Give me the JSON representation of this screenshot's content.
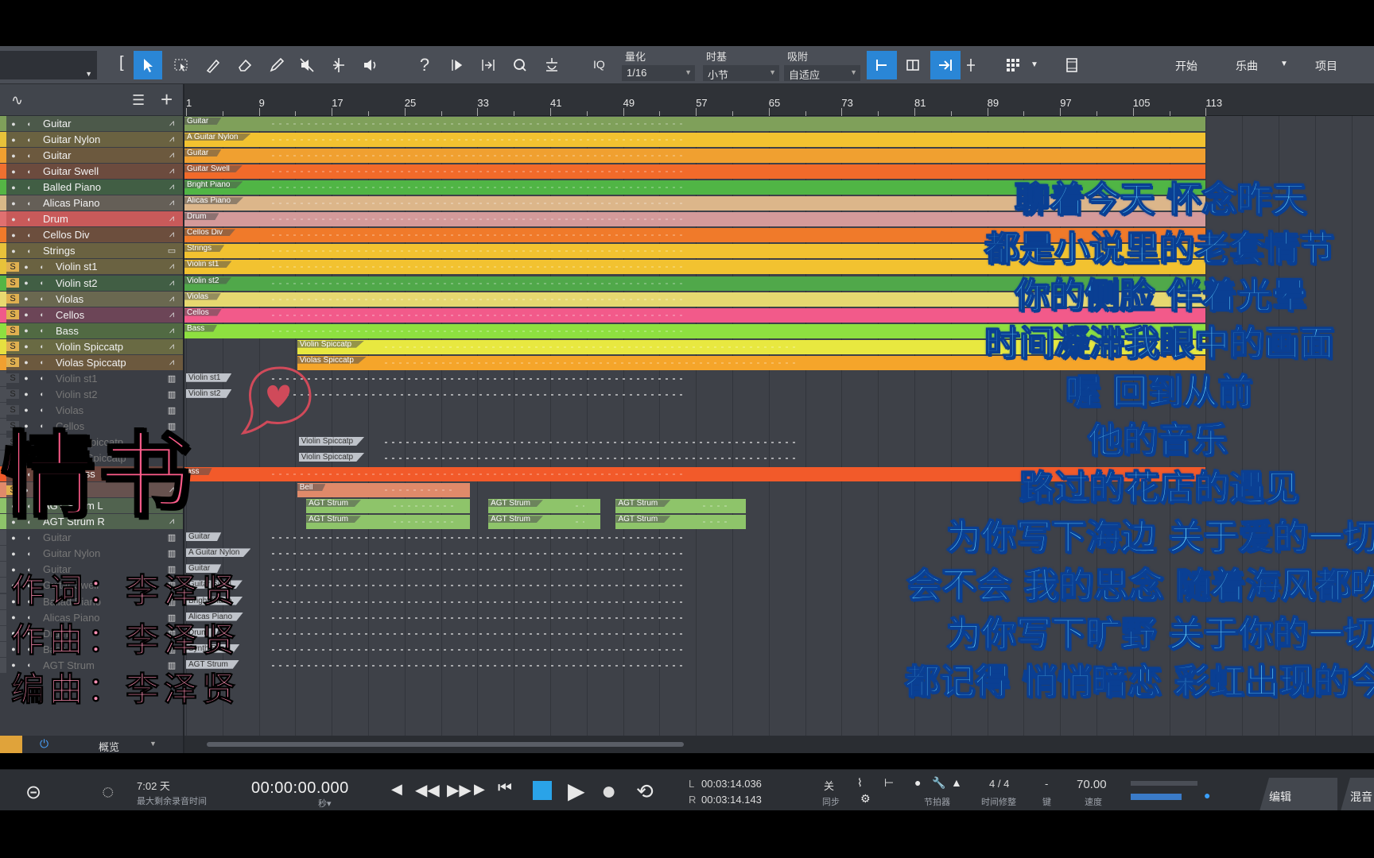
{
  "toolbar": {
    "quantize_label": "量化",
    "quantize_value": "1/16",
    "timebase_label": "时基",
    "timebase_value": "小节",
    "snap_label": "吸附",
    "snap_value": "自适应",
    "iq_label": "IQ",
    "start_label": "开始",
    "song_label": "乐曲",
    "project_label": "项目"
  },
  "tracks": [
    {
      "name": "Guitar",
      "color": "#7fa05a"
    },
    {
      "name": "Guitar Nylon",
      "color": "#e8c23a"
    },
    {
      "name": "Guitar",
      "color": "#f0a030"
    },
    {
      "name": "Guitar Swell",
      "color": "#f07030"
    },
    {
      "name": "Balled Piano",
      "color": "#55b545"
    },
    {
      "name": "Alicas Piano",
      "color": "#d8b888"
    },
    {
      "name": "Drum",
      "color": "#e07070"
    },
    {
      "name": "Cellos Div",
      "color": "#f07a2a"
    },
    {
      "name": "Strings",
      "color": "#e8c23a"
    },
    {
      "name": "Violin st1",
      "color": "#e8c23a"
    },
    {
      "name": "Violin  st2",
      "color": "#55b545"
    },
    {
      "name": "Violas",
      "color": "#e8d870"
    },
    {
      "name": "Cellos",
      "color": "#f05a8a"
    },
    {
      "name": "Bass",
      "color": "#8ee040"
    },
    {
      "name": "Violin Spiccatp",
      "color": "#e6e040"
    },
    {
      "name": "Violas Spiccatp",
      "color": "#f0a030"
    },
    {
      "name": "Violin st1",
      "color": "#555"
    },
    {
      "name": "Violin  st2",
      "color": "#555"
    },
    {
      "name": "Violas",
      "color": "#555"
    },
    {
      "name": "Cellos",
      "color": "#555"
    },
    {
      "name": "Violin Spiccatp",
      "color": "#555"
    },
    {
      "name": "Violas Spiccatp",
      "color": "#555"
    },
    {
      "name": "Synth Bass",
      "color": "#f05a2a"
    },
    {
      "name": "Bell",
      "color": "#e08a6a"
    },
    {
      "name": "AGT Strum L",
      "color": "#8ec46a"
    },
    {
      "name": "AGT Strum R",
      "color": "#8ec46a"
    },
    {
      "name": "Guitar",
      "color": "#555"
    },
    {
      "name": "Guitar Nylon",
      "color": "#555"
    },
    {
      "name": "Guitar",
      "color": "#555"
    },
    {
      "name": "Guitar Swell",
      "color": "#555"
    },
    {
      "name": "Ballad Piano",
      "color": "#555"
    },
    {
      "name": "Alicas Piano",
      "color": "#555"
    },
    {
      "name": "Drum",
      "color": "#555"
    },
    {
      "name": "Bass",
      "color": "#555"
    },
    {
      "name": "AGT Strum",
      "color": "#555"
    }
  ],
  "ruler_marks": [
    "1",
    "9",
    "17",
    "25",
    "33",
    "41",
    "49",
    "57",
    "65",
    "73",
    "81",
    "89",
    "97",
    "105",
    "113"
  ],
  "clips": {
    "guitar": "Guitar",
    "guitar_nylon": "A Guitar Nylon",
    "guitar2": "Guitar",
    "guitar_swell": "Guitar Swell",
    "bright_piano": "Bright Piano",
    "alicas_piano": "Alicas Piano",
    "drum": "Drum",
    "cellos_div": "Cellos Div",
    "strings": "Strings",
    "violin_st1": "Violin st1",
    "violin_st2": "Violin  st2",
    "violas": "Violas",
    "cellos": "Cellos",
    "bass": "Bass",
    "violin_spiccatp": "Violin Spiccatp",
    "violas_spiccatp": "Violas Spiccatp",
    "ghost_violin_st1": "Violin st1",
    "ghost_violin_st2": "Violin  st2",
    "ghost_violin_spiccatp": "Violin Spiccatp",
    "ghost_violin_spiccatp2": "Violin Spiccatp",
    "synth_bass": "ass",
    "bell": "Bell",
    "agt_strum": "AGT Strum",
    "ghost_guitar": "Guitar",
    "ghost_nylon": "A Guitar Nylon",
    "ghost_guitar2": "Guitar",
    "ghost_swell": "Guitar Swell",
    "ghost_bright_piano": "Bright Piano",
    "ghost_alicas_piano": "Alicas Piano",
    "ghost_drum": "Drum",
    "ghost_synth_bass": "Synth Bass",
    "ghost_agt_strum": "AGT Strum"
  },
  "footer": {
    "overview_label": "概览"
  },
  "transport": {
    "remaining_days": "7:02 天",
    "remaining_label": "最大剩余录音时间",
    "time_display": "00:00:00.000",
    "time_unit": "秒▾",
    "loop_l_prefix": "L",
    "loop_l": "00:03:14.036",
    "loop_r_prefix": "R",
    "loop_r": "00:03:14.143",
    "sync_off": "关",
    "sync_label": "同步",
    "metronome_label": "节拍器",
    "time_signature": "4 / 4",
    "time_sig_label": "时间修整",
    "key_value": "-",
    "key_label": "键",
    "tempo": "70.00",
    "tempo_label": "速度",
    "edit_tab": "编辑",
    "mix_tab": "混音"
  },
  "overlay": {
    "title": "情书",
    "credits": [
      "作词：李泽贤",
      "作曲：李泽贤",
      "编曲：李泽贤"
    ],
    "lyrics": [
      "聊着今天 怀念昨天",
      "都是小说里的老套情节",
      "你的侧脸 伴着光晕",
      "时间凝滞我眼中的画面",
      "喔 回到从前",
      "他的音乐",
      "路过的花店的遇见",
      "为你写下海边 关于爱的一切",
      "会不会 我的思念 随着海风都吹",
      "为你写下旷野 关于你的一切",
      "都记得 悄悄暗恋 彩虹出现的今"
    ]
  }
}
